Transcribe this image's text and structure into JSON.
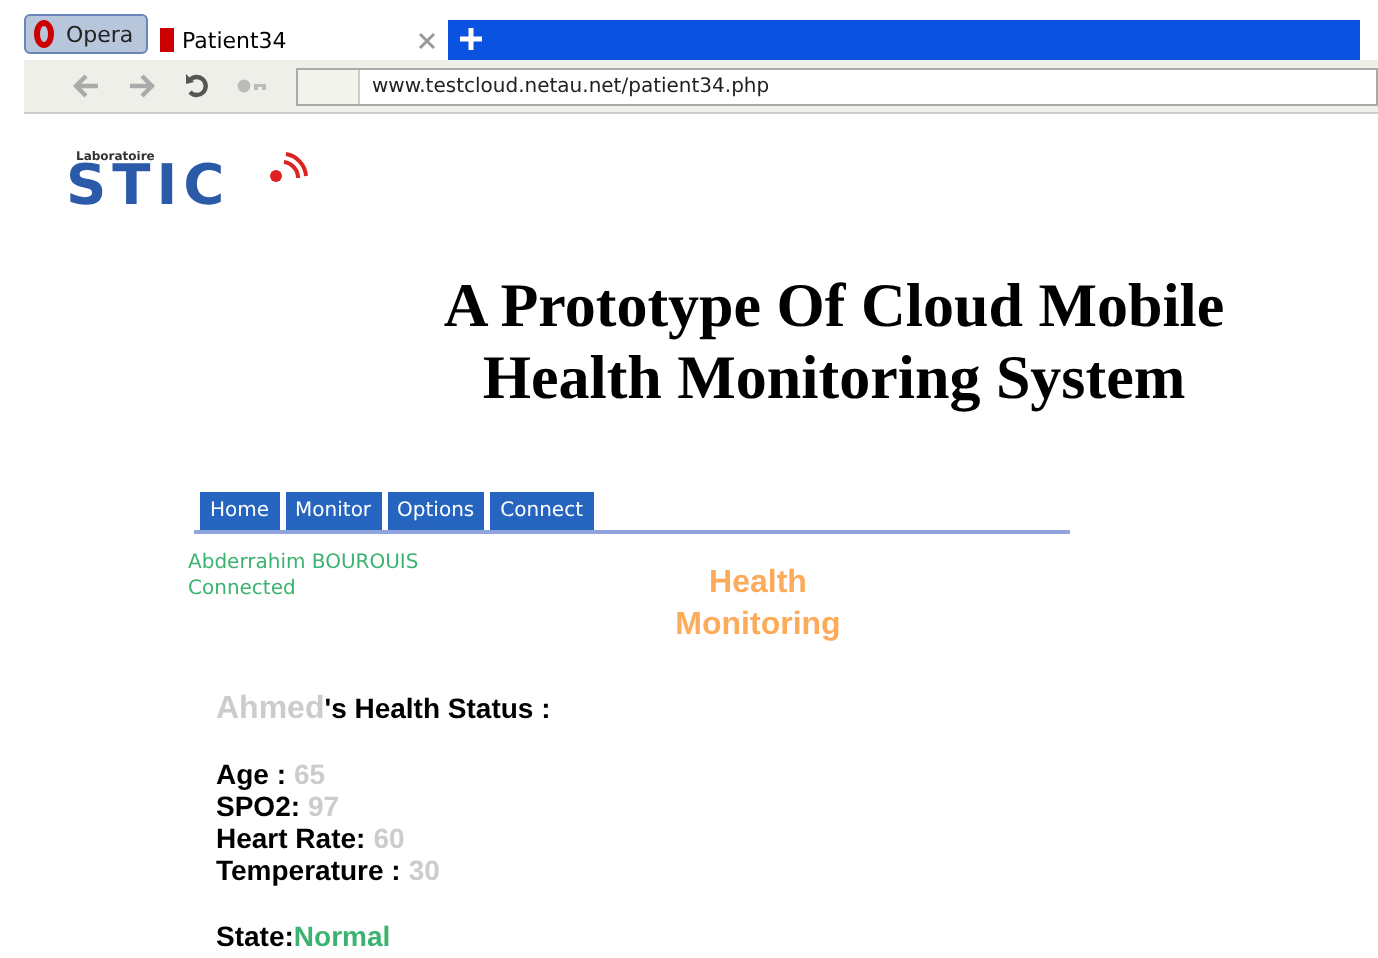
{
  "browser": {
    "menu_button": "Opera",
    "tabs": [
      {
        "label": "Patient34",
        "selected": true
      }
    ],
    "address": "www.testcloud.netau.net/patient34.php"
  },
  "logo": {
    "small": "Laboratoire",
    "big": "STIC"
  },
  "title": "A Prototype Of Cloud Mobile Health Monitoring System",
  "nav": [
    "Home",
    "Monitor",
    "Options",
    "Connect"
  ],
  "user": {
    "name": "Abderrahim BOUROUIS",
    "status": "Connected"
  },
  "section_title": "Health Monitoring",
  "patient": {
    "name": "Ahmed",
    "heading": "'s Health Status :"
  },
  "vitals": [
    {
      "label": "Age :",
      "value": "65"
    },
    {
      "label": "SPO2:",
      "value": "97"
    },
    {
      "label": "Heart Rate:",
      "value": "60"
    },
    {
      "label": "Temperature :",
      "value": "30"
    }
  ],
  "state": {
    "label": "State:",
    "value": "Normal"
  }
}
